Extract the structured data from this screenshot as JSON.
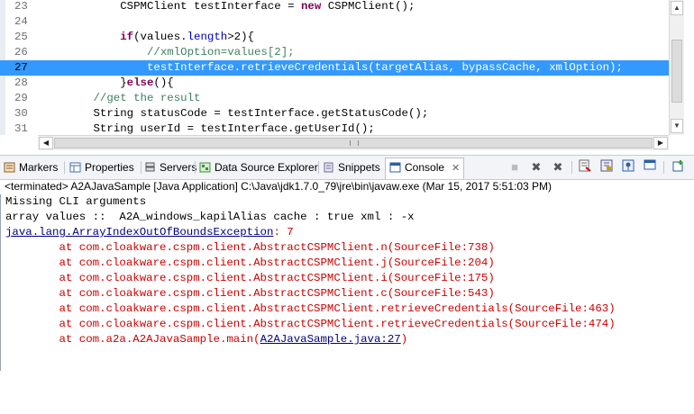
{
  "editor": {
    "lines": [
      {
        "num": "23",
        "tokens": [
          {
            "t": "            CSPMClient testInterface = ",
            "c": "pl"
          },
          {
            "t": "new",
            "c": "kw"
          },
          {
            "t": " CSPMClient();",
            "c": "pl"
          }
        ]
      },
      {
        "num": "24",
        "tokens": []
      },
      {
        "num": "25",
        "tokens": [
          {
            "t": "            ",
            "c": "pl"
          },
          {
            "t": "if",
            "c": "kw"
          },
          {
            "t": "(values.",
            "c": "pl"
          },
          {
            "t": "length",
            "c": "fd"
          },
          {
            "t": ">2){",
            "c": "pl"
          }
        ]
      },
      {
        "num": "26",
        "tokens": [
          {
            "t": "                ",
            "c": "pl"
          },
          {
            "t": "//xmlOption=values[2];",
            "c": "cm"
          }
        ]
      },
      {
        "num": "27",
        "highlighted": true,
        "tokens": [
          {
            "t": "                testInterface.retrieveCredentials(targetAlias, bypassCache, xmlOption);",
            "c": "pl"
          }
        ]
      },
      {
        "num": "28",
        "tokens": [
          {
            "t": "            }",
            "c": "pl"
          },
          {
            "t": "else",
            "c": "kw"
          },
          {
            "t": "(){",
            "c": "pl"
          }
        ]
      },
      {
        "num": "29",
        "tokens": [
          {
            "t": "        ",
            "c": "pl"
          },
          {
            "t": "//get the result",
            "c": "cm"
          }
        ]
      },
      {
        "num": "30",
        "tokens": [
          {
            "t": "        String statusCode = testInterface.getStatusCode();",
            "c": "pl"
          }
        ]
      },
      {
        "num": "31",
        "tokens": [
          {
            "t": "        String userId = testInterface.getUserId();",
            "c": "pl"
          }
        ]
      }
    ]
  },
  "tabs": [
    {
      "id": "markers",
      "label": "Markers",
      "icon": "markers-icon",
      "color": "#8a5a2b"
    },
    {
      "id": "properties",
      "label": "Properties",
      "icon": "properties-icon",
      "color": "#4a6fa5"
    },
    {
      "id": "servers",
      "label": "Servers",
      "icon": "servers-icon",
      "color": "#555555"
    },
    {
      "id": "datasource",
      "label": "Data Source Explorer",
      "icon": "data-source-explorer-icon",
      "color": "#3f8f3f"
    },
    {
      "id": "snippets",
      "label": "Snippets",
      "icon": "snippets-icon",
      "color": "#6b6b9a"
    },
    {
      "id": "console",
      "label": "Console",
      "icon": "console-icon",
      "color": "#2a5ea8",
      "active": true
    }
  ],
  "console": {
    "description": "<terminated> A2AJavaSample [Java Application] C:\\Java\\jdk1.7.0_79\\jre\\bin\\javaw.exe (Mar 15, 2017 5:51:03 PM)",
    "output": [
      {
        "type": "out",
        "text": "Missing CLI arguments"
      },
      {
        "type": "out",
        "text": "array values ::  A2A_windows_kapilAlias cache : true xml : -x"
      },
      {
        "type": "exception",
        "link": "java.lang.ArrayIndexOutOfBoundsException",
        "rest": ": 7"
      },
      {
        "type": "err",
        "text": "\tat com.cloakware.cspm.client.AbstractCSPMClient.n(SourceFile:738)"
      },
      {
        "type": "err",
        "text": "\tat com.cloakware.cspm.client.AbstractCSPMClient.j(SourceFile:204)"
      },
      {
        "type": "err",
        "text": "\tat com.cloakware.cspm.client.AbstractCSPMClient.i(SourceFile:175)"
      },
      {
        "type": "err",
        "text": "\tat com.cloakware.cspm.client.AbstractCSPMClient.c(SourceFile:543)"
      },
      {
        "type": "err",
        "text": "\tat com.cloakware.cspm.client.AbstractCSPMClient.retrieveCredentials(SourceFile:463)"
      },
      {
        "type": "err",
        "text": "\tat com.cloakware.cspm.client.AbstractCSPMClient.retrieveCredentials(SourceFile:474)"
      },
      {
        "type": "errlink",
        "pre": "\tat com.a2a.A2AJavaSample.main(",
        "link": "A2AJavaSample.java:27",
        "post": ")"
      }
    ]
  },
  "toolbar": {
    "terminate_icon": "terminate-icon",
    "remove_launch_icon": "remove-launch-icon",
    "remove_all_icon": "remove-all-terminated-icon",
    "clear_console_icon": "clear-console-icon",
    "scroll_lock_icon": "scroll-lock-icon",
    "pin_console_icon": "pin-console-icon",
    "display_selected_icon": "display-selected-console-icon",
    "open_console_icon": "open-console-icon"
  },
  "colors": {
    "selection": "#3399ff",
    "error": "#cc0000",
    "link": "#000080",
    "keyword": "#7f0055",
    "comment": "#3f7f5f"
  }
}
